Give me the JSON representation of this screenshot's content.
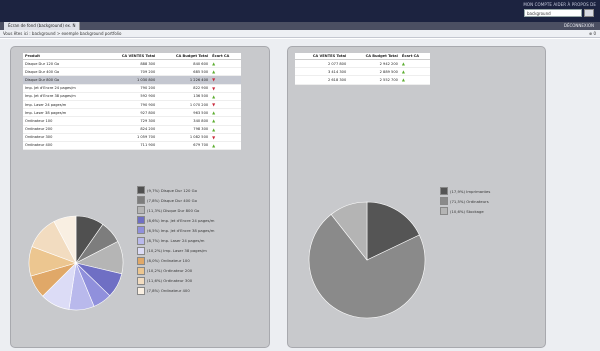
{
  "header": {
    "links": "MON COMPTE  AIDER  À PROPOS DE",
    "search_value": "background"
  },
  "tabbar": {
    "tab_label": "Écran de fond (background) ex. N",
    "actions": "DÉCONNEXION"
  },
  "breadcrumb": {
    "path": "Vous êtes ici : background > exemple background portfolio",
    "right": "⊕ 0"
  },
  "table1": {
    "headers": [
      "Produit",
      "CA VENTES Total",
      "CA Budget Total",
      "Écart CA"
    ],
    "rows": [
      {
        "product": "Disque Dur 120 Go",
        "ventes": "888 300",
        "budget": "840 600",
        "trend": "up"
      },
      {
        "product": "Disque Dur 400 Go",
        "ventes": "709 200",
        "budget": "685 500",
        "trend": "up"
      },
      {
        "product": "Disque Dur 800 Go",
        "ventes": "1 030 800",
        "budget": "1 226 400",
        "trend": "down"
      },
      {
        "product": "Imp. Jet d'Encre 24 pages/m",
        "ventes": "790 200",
        "budget": "822 900",
        "trend": "down"
      },
      {
        "product": "Imp. Jet d'Encre 38 pages/m",
        "ventes": "592 900",
        "budget": "136 500",
        "trend": "up"
      },
      {
        "product": "Imp. Laser 24 pages/m",
        "ventes": "790 900",
        "budget": "1 070 200",
        "trend": "down"
      },
      {
        "product": "Imp. Laser 38 pages/m",
        "ventes": "927 800",
        "budget": "963 500",
        "trend": "up"
      },
      {
        "product": "Ordinateur 100",
        "ventes": "729 300",
        "budget": "340 800",
        "trend": "up"
      },
      {
        "product": "Ordinateur 200",
        "ventes": "824 200",
        "budget": "798 300",
        "trend": "up"
      },
      {
        "product": "Ordinateur 300",
        "ventes": "1 059 700",
        "budget": "1 082 500",
        "trend": "down"
      },
      {
        "product": "Ordinateur 400",
        "ventes": "711 900",
        "budget": "679 700",
        "trend": "up"
      }
    ]
  },
  "table2": {
    "headers": [
      "CA VENTES Total",
      "CA Budget Total",
      "Écart CA"
    ],
    "rows": [
      {
        "ventes": "2 077 800",
        "budget": "2 942 200",
        "trend": "up"
      },
      {
        "ventes": "3 414 300",
        "budget": "2 889 500",
        "trend": "up"
      },
      {
        "ventes": "2 618 300",
        "budget": "2 552 700",
        "trend": "up"
      }
    ]
  },
  "legend1": [
    "(9,7%) Disque Dur 120 Go",
    "(7,8%) Disque Dur 400 Go",
    "(11,3%) Disque Dur 800 Go",
    "(8,6%) Imp. Jet d'Encre 24 pages/m",
    "(6,5%) Imp. Jet d'Encre 38 pages/m",
    "(8,7%) Imp. Laser 24 pages/m",
    "(10,2%) Imp. Laser 38 pages/m",
    "(8,0%) Ordinateur 100",
    "(10,2%) Ordinateur 200",
    "(11,6%) Ordinateur 300",
    "(7,8%) Ordinateur 400"
  ],
  "legend2": [
    "(17,9%) Imprimantes",
    "(71,5%) Ordinateurs",
    "(10,6%) Stockage"
  ],
  "chart_data": [
    {
      "type": "pie",
      "categories": [
        "Disque Dur 120 Go",
        "Disque Dur 400 Go",
        "Disque Dur 800 Go",
        "Imp. Jet d'Encre 24 pages/m",
        "Imp. Jet d'Encre 38 pages/m",
        "Imp. Laser 24 pages/m",
        "Imp. Laser 38 pages/m",
        "Ordinateur 100",
        "Ordinateur 200",
        "Ordinateur 300",
        "Ordinateur 400"
      ],
      "values": [
        9.7,
        7.8,
        11.3,
        8.6,
        6.5,
        8.7,
        10.2,
        8.0,
        10.2,
        11.6,
        7.8
      ],
      "colors": [
        "#505050",
        "#7d7d7d",
        "#b5b5b5",
        "#6f6fc4",
        "#9090dc",
        "#b9b9ec",
        "#dcdcf6",
        "#e0a868",
        "#ecc690",
        "#f2dcc0",
        "#f9efe2"
      ]
    },
    {
      "type": "pie",
      "categories": [
        "Imprimantes",
        "Ordinateurs",
        "Stockage"
      ],
      "values": [
        17.9,
        71.5,
        10.6
      ],
      "colors": [
        "#555555",
        "#8a8a8a",
        "#b4b4b4"
      ]
    }
  ]
}
